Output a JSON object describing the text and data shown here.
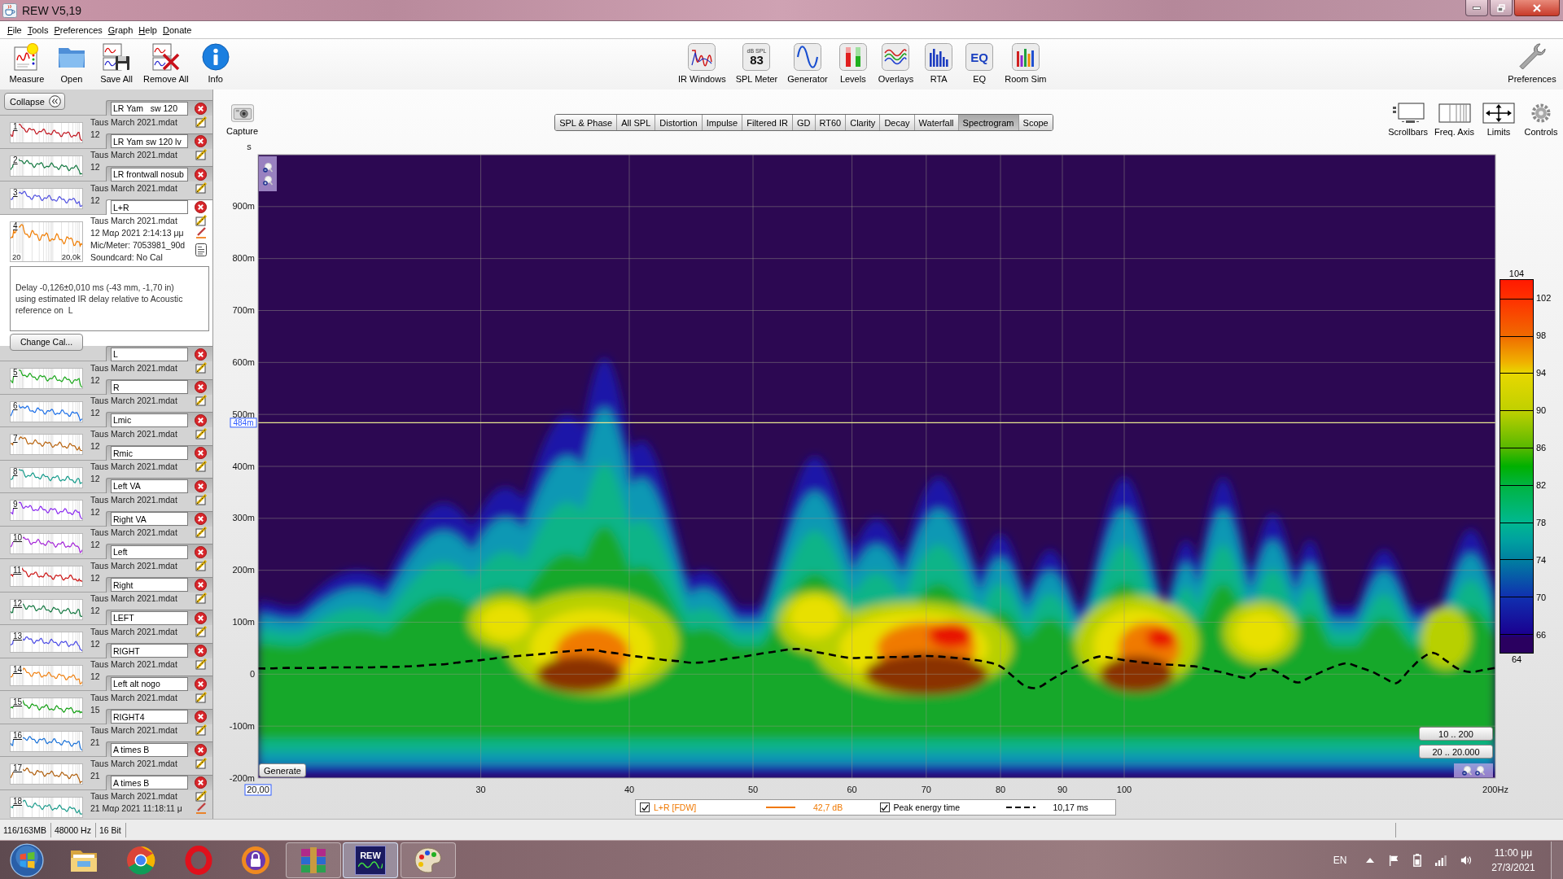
{
  "window": {
    "title": "REW V5,19"
  },
  "menu": [
    "File",
    "Tools",
    "Preferences",
    "Graph",
    "Help",
    "Donate"
  ],
  "toolbar": {
    "main": [
      {
        "kind": "measure",
        "label": "Measure"
      },
      {
        "kind": "open",
        "label": "Open"
      },
      {
        "kind": "save-all",
        "label": "Save All"
      },
      {
        "kind": "remove-all",
        "label": "Remove All"
      },
      {
        "kind": "info",
        "label": "Info"
      }
    ],
    "tools": [
      {
        "kind": "ir-windows",
        "label": "IR Windows"
      },
      {
        "kind": "spl-meter",
        "label": "SPL Meter",
        "icon_text": [
          "dB SPL",
          "83"
        ]
      },
      {
        "kind": "generator",
        "label": "Generator"
      },
      {
        "kind": "levels",
        "label": "Levels"
      },
      {
        "kind": "overlays",
        "label": "Overlays"
      },
      {
        "kind": "rta",
        "label": "RTA"
      },
      {
        "kind": "eq",
        "label": "EQ",
        "icon_text": [
          "EQ"
        ]
      },
      {
        "kind": "room-sim",
        "label": "Room Sim"
      }
    ],
    "preferences": "Preferences"
  },
  "sidebar": {
    "collapse": "Collapse",
    "measurements": [
      {
        "number": "1",
        "name": "LR Yam   sw 120",
        "file": "Taus March 2021.mdat",
        "date": "12",
        "color": "#c0141e",
        "selected": false
      },
      {
        "number": "2",
        "name": "LR Yam sw 120 lv",
        "file": "Taus March 2021.mdat",
        "date": "12",
        "color": "#137840",
        "selected": false
      },
      {
        "number": "3",
        "name": "LR frontwall nosub",
        "file": "Taus March 2021.mdat",
        "date": "12",
        "color": "#5050e0",
        "selected": false
      },
      {
        "number": "4",
        "name": "L+R",
        "file": "Taus March 2021.mdat",
        "date": "12 Μαρ 2021 2:14:13 μμ",
        "mic": "Mic/Meter: 7053981_90d",
        "soundcard": "Soundcard: No Cal",
        "axis": [
          "20",
          "20,0k"
        ],
        "notes": "Delay -0,126±0,010 ms (-43 mm, -1,70 in) using estimated IR delay relative to Acoustic reference on  L",
        "button": "Change Cal...",
        "color": "#f07c00",
        "selected": true
      },
      {
        "number": "5",
        "name": "L",
        "file": "Taus March 2021.mdat",
        "date": "12",
        "color": "#1ca81c",
        "selected": false
      },
      {
        "number": "6",
        "name": "R",
        "file": "Taus March 2021.mdat",
        "date": "12",
        "color": "#1a6ee8",
        "selected": false
      },
      {
        "number": "7",
        "name": "Lmic",
        "file": "Taus March 2021.mdat",
        "date": "12",
        "color": "#b8620c",
        "selected": false
      },
      {
        "number": "8",
        "name": "Rmic",
        "file": "Taus March 2021.mdat",
        "date": "12",
        "color": "#169c8c",
        "selected": false
      },
      {
        "number": "9",
        "name": "Left VA",
        "file": "Taus March 2021.mdat",
        "date": "12",
        "color": "#8a28f0",
        "selected": false
      },
      {
        "number": "10",
        "name": "Right VA",
        "file": "Taus March 2021.mdat",
        "date": "12",
        "color": "#a424d8",
        "selected": false
      },
      {
        "number": "11",
        "name": "Left",
        "file": "Taus March 2021.mdat",
        "date": "12",
        "color": "#cc1414",
        "selected": false
      },
      {
        "number": "12",
        "name": "Right",
        "file": "Taus March 2021.mdat",
        "date": "12",
        "color": "#137840",
        "selected": false
      },
      {
        "number": "13",
        "name": "LEFT",
        "file": "Taus March 2021.mdat",
        "date": "12",
        "color": "#4a4ae6",
        "selected": false
      },
      {
        "number": "14",
        "name": "RIGHT",
        "file": "Taus March 2021.mdat",
        "date": "12",
        "color": "#f08010",
        "selected": false
      },
      {
        "number": "15",
        "name": "Left alt nogo",
        "file": "Taus March 2021.mdat",
        "date": "15",
        "color": "#14a014",
        "selected": false
      },
      {
        "number": "16",
        "name": "RIGHT4",
        "file": "Taus March 2021.mdat",
        "date": "21",
        "color": "#1a72d8",
        "selected": false
      },
      {
        "number": "17",
        "name": "A times B",
        "file": "Taus March 2021.mdat",
        "date": "21",
        "color": "#b0600e",
        "selected": false
      },
      {
        "number": "18",
        "name": "A times B",
        "file": "Taus March 2021.mdat",
        "date": "21 Μαρ 2021 11:18:11 μ",
        "color": "#1c9c8c",
        "selected": false
      }
    ]
  },
  "graph": {
    "capture": "Capture",
    "tabs": [
      {
        "label": "SPL & Phase",
        "selected": false
      },
      {
        "label": "All SPL",
        "selected": false
      },
      {
        "label": "Distortion",
        "selected": false
      },
      {
        "label": "Impulse",
        "selected": false
      },
      {
        "label": "Filtered IR",
        "selected": false
      },
      {
        "label": "GD",
        "selected": false
      },
      {
        "label": "RT60",
        "selected": false
      },
      {
        "label": "Clarity",
        "selected": false
      },
      {
        "label": "Decay",
        "selected": false
      },
      {
        "label": "Waterfall",
        "selected": false
      },
      {
        "label": "Spectrogram",
        "selected": true
      },
      {
        "label": "Scope",
        "selected": false
      }
    ],
    "controls": [
      {
        "kind": "scrollbars",
        "label": "Scrollbars"
      },
      {
        "kind": "freq-axis",
        "label": "Freq. Axis"
      },
      {
        "kind": "limits",
        "label": "Limits"
      },
      {
        "kind": "controls",
        "label": "Controls"
      }
    ],
    "chart_data": {
      "type": "line",
      "ylabel": "s",
      "grid": true,
      "categories": [
        null,
        null,
        null,
        null,
        null,
        null,
        null,
        null,
        null,
        null,
        null,
        null,
        null,
        null,
        null,
        null,
        null,
        null,
        "30",
        null,
        null,
        null,
        null,
        null,
        null,
        null,
        null,
        null,
        null,
        null,
        "40",
        null,
        null,
        null,
        null,
        null,
        null,
        null,
        null,
        null,
        "50",
        null,
        null,
        null,
        null,
        null,
        null,
        null,
        "60",
        null,
        null,
        null,
        null,
        null,
        "70",
        null,
        null,
        null,
        null,
        null,
        "80",
        null,
        null,
        null,
        null,
        "90",
        null,
        null,
        null,
        null,
        "100",
        null,
        null,
        null,
        null,
        null,
        null,
        null,
        null,
        null,
        null,
        null,
        null,
        null,
        null,
        null,
        null,
        null,
        null,
        null,
        null,
        null,
        null,
        null,
        null,
        null,
        null,
        null,
        null,
        null,
        "200Hz"
      ],
      "series": [
        {
          "color": "#000000",
          "line_style": "dashed",
          "values": [
            11,
            11,
            12,
            12,
            12,
            12,
            13,
            13,
            13,
            13,
            14,
            14,
            15,
            16,
            18,
            19,
            22,
            25,
            27,
            30,
            33,
            35,
            37,
            39,
            42,
            44,
            46,
            47,
            43,
            40,
            36,
            33,
            30,
            27,
            25,
            22,
            23,
            26,
            30,
            33,
            37,
            41,
            44,
            48,
            48,
            43,
            39,
            34,
            31,
            32,
            32,
            33,
            33,
            34,
            35,
            34,
            32,
            30,
            27,
            23,
            15,
            -4,
            -23,
            -26,
            -12,
            2,
            14,
            26,
            34,
            31,
            27,
            24,
            21,
            19,
            18,
            16,
            14,
            8,
            3,
            -3,
            -7,
            8,
            8,
            -5,
            -16,
            -6,
            5,
            15,
            21,
            13,
            5,
            -7,
            -17,
            7,
            30,
            41,
            26,
            10,
            4,
            8,
            12
          ]
        }
      ],
      "ylim": [
        -200,
        1000
      ],
      "yticks": [
        {
          "value": 900,
          "label": "900m"
        },
        {
          "value": 800,
          "label": "800m"
        },
        {
          "value": 700,
          "label": "700m"
        },
        {
          "value": 600,
          "label": "600m"
        },
        {
          "value": 500,
          "label": "500m"
        },
        {
          "value": 400,
          "label": "400m"
        },
        {
          "value": 300,
          "label": "300m"
        },
        {
          "value": 200,
          "label": "200m"
        },
        {
          "value": 100,
          "label": "100m"
        },
        0,
        {
          "value": -100,
          "label": "-100m"
        },
        {
          "value": -200,
          "label": "-200m"
        }
      ],
      "ref_lines": [
        {
          "axis": "y",
          "value": 484,
          "label": "484m"
        }
      ],
      "annotations": [
        "20,00"
      ]
    },
    "buttons": {
      "generate": "Generate",
      "ranges": [
        "10 .. 200",
        "20 .. 20.000"
      ]
    },
    "color_scale": {
      "max": "104",
      "min": "64",
      "ticks": [
        "102",
        "98",
        "94",
        "90",
        "86",
        "82",
        "78",
        "74",
        "70",
        "66"
      ]
    },
    "legend": [
      {
        "kind": "solid",
        "checked": true,
        "label": "L+R [FDW]",
        "color": "#f07800",
        "reading": "42,7 dB"
      },
      {
        "kind": "dashed",
        "checked": true,
        "label": "Peak energy time",
        "color": "#000000",
        "reading": "10,17 ms"
      }
    ]
  },
  "status_bar": [
    "116/163MB",
    "48000 Hz",
    "16 Bit"
  ],
  "taskbar": {
    "apps": [
      {
        "kind": "folder",
        "running": false,
        "selected": false
      },
      {
        "kind": "segments",
        "running": false,
        "selected": false
      },
      {
        "kind": "ring",
        "running": false,
        "selected": false
      },
      {
        "kind": "padlock",
        "running": false,
        "selected": false
      },
      {
        "kind": "books",
        "running": true,
        "selected": false
      },
      {
        "kind": "logo",
        "icon_text": "REW",
        "running": true,
        "selected": true
      },
      {
        "kind": "palette",
        "running": true,
        "selected": false
      }
    ],
    "tray": {
      "language": "EN",
      "time": "11:00 μμ",
      "date": "27/3/2021"
    }
  }
}
